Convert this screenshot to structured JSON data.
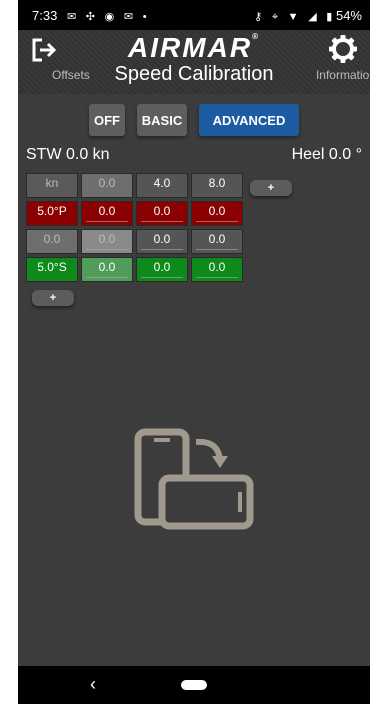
{
  "status": {
    "time": "7:33",
    "battery": "54%"
  },
  "header": {
    "brand": "AIRMAR",
    "brand_mark": "®"
  },
  "nav": {
    "left": "Offsets",
    "title": "Speed Calibration",
    "right": "Information"
  },
  "modes": {
    "off": "OFF",
    "basic": "BASIC",
    "advanced": "ADVANCED",
    "active": "ADVANCED"
  },
  "readouts": {
    "stw": "STW 0.0 kn",
    "heel": "Heel 0.0 °"
  },
  "table": {
    "header": [
      "kn",
      "0.0",
      "4.0",
      "8.0"
    ],
    "rows": [
      [
        "5.0°P",
        "0.0",
        "0.0",
        "0.0"
      ],
      [
        "0.0",
        "0.0",
        "0.0",
        "0.0"
      ],
      [
        "5.0°S",
        "0.0",
        "0.0",
        "0.0"
      ]
    ]
  },
  "add_label": "+",
  "colors": {
    "background": "#3c3c3c",
    "accent": "#1d5ca3",
    "port": "#8b0000",
    "starboard": "#0d8a1a"
  },
  "icons": [
    "exit-icon",
    "gear-icon",
    "rotate-device-icon",
    "back-icon",
    "home-icon"
  ]
}
